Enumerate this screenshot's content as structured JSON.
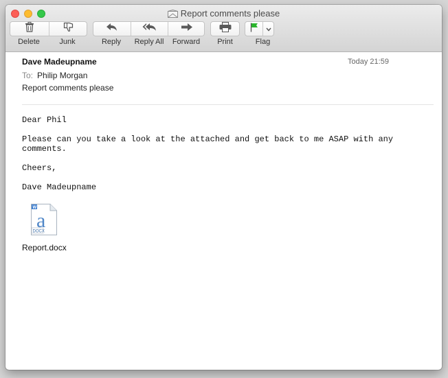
{
  "window": {
    "title": "Report comments please"
  },
  "toolbar": {
    "delete_label": "Delete",
    "junk_label": "Junk",
    "reply_label": "Reply",
    "reply_all_label": "Reply All",
    "forward_label": "Forward",
    "print_label": "Print",
    "flag_label": "Flag"
  },
  "message": {
    "from": "Dave Madeupname",
    "date": "Today 21:59",
    "to_label": "To:",
    "to": "Philip Morgan",
    "subject": "Report comments please",
    "body": [
      "Dear Phil",
      "Please can you take a look at the attached and get back to me ASAP with any",
      "comments.",
      "Cheers,",
      "Dave Madeupname"
    ],
    "attachment": {
      "name": "Report.docx",
      "icon": "docx-file-icon",
      "badge": "DOCX",
      "letter": "a"
    }
  },
  "colors": {
    "close": "#fc5f57",
    "minimize": "#fdbc2e",
    "zoom": "#34c84a",
    "flag": "#2bb52d"
  }
}
